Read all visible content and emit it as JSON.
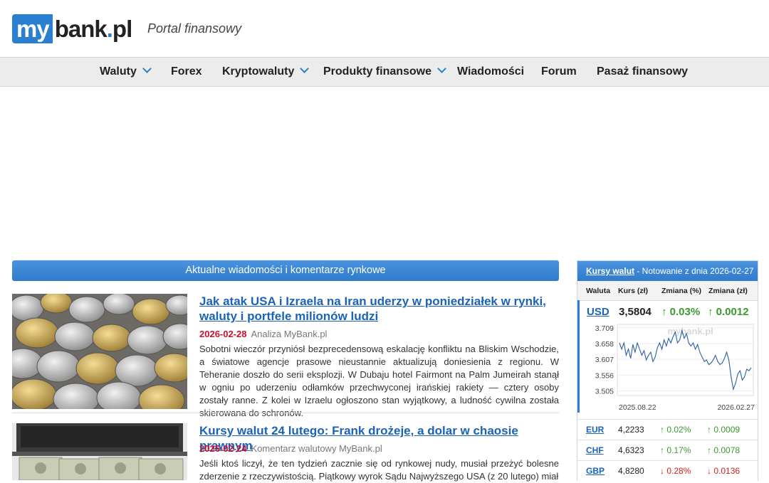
{
  "header": {
    "logo_my": "my",
    "logo_bank": "bank",
    "logo_dot": ".",
    "logo_pl": "pl",
    "tagline": "Portal finansowy"
  },
  "nav": {
    "items": [
      {
        "label": "Waluty",
        "dropdown": true
      },
      {
        "label": "Forex",
        "dropdown": false
      },
      {
        "label": "Kryptowaluty",
        "dropdown": true
      },
      {
        "label": "Produkty finansowe",
        "dropdown": true
      },
      {
        "label": "Wiadomości",
        "dropdown": false
      },
      {
        "label": "Forum",
        "dropdown": false
      },
      {
        "label": "Pasaż finansowy",
        "dropdown": false
      }
    ]
  },
  "news": {
    "section_title": "Aktualne wiadomości i komentarze rynkowe",
    "articles": [
      {
        "title": "Jak atak USA i Izraela na Iran uderzy w poniedziałek w rynki, waluty i portfele milionów ludzi",
        "date": "2026-02-28",
        "category": "Analiza MyBank.pl",
        "text": "Sobotni wieczór przyniósł bezprecedensową eskalację konfliktu na Bliskim Wschodzie, a światowe agencje prasowe nieustannie aktualizują doniesienia z regionu. W Teheranie doszło do serii eksplozji. W Dubaju hotel Fairmont na Palm Jumeirah stanął w ogniu po uderzeniu odłamków przechwyconej irańskiej rakiety — cztery osoby zostały ranne. Z kolei w Izraelu ogłoszono stan wyjątkowy, a ludność cywilna została skierowana do schronów."
      },
      {
        "title": "Kursy walut 24 lutego: Frank drożeje, a dolar w chaosie prawnym",
        "date": "2026-02-24",
        "category": "Komentarz walutowy MyBank.pl",
        "text": "Jeśli ktoś liczył, że ten tydzień zacznie się od rynkowej nudy, musiał przeżyć bolesne zderzenie z rzeczywistością. Piątkowy wyrok Sądu Najwyższego USA (z 20 lutego) miał"
      }
    ]
  },
  "rates": {
    "header_link": "Kursy walut",
    "header_suffix": " - Notowanie z dnia 2026-02-27",
    "columns": [
      "Waluta",
      "Kurs (zł)",
      "Zmiana (%)",
      "Zmiana (zł)"
    ],
    "usd": {
      "code": "USD",
      "rate": "3,5804",
      "pct": "↑ 0.03%",
      "chg": "↑ 0.0012"
    },
    "chart_watermark": "mybank.pl",
    "chart_data": {
      "type": "line",
      "title": "",
      "x_labels": [
        "2025.08.22",
        "2026.02.27"
      ],
      "y_ticks": [
        3.709,
        3.658,
        3.607,
        3.556,
        3.505
      ],
      "ylim": [
        3.49,
        3.72
      ],
      "values": [
        3.66,
        3.64,
        3.66,
        3.62,
        3.64,
        3.61,
        3.655,
        3.63,
        3.66,
        3.64,
        3.62,
        3.635,
        3.605,
        3.62,
        3.63,
        3.6,
        3.615,
        3.645,
        3.66,
        3.64,
        3.67,
        3.65,
        3.675,
        3.66,
        3.68,
        3.695,
        3.66,
        3.67,
        3.7,
        3.675,
        3.69,
        3.66,
        3.65,
        3.66,
        3.64,
        3.655,
        3.63,
        3.615,
        3.6,
        3.605,
        3.59,
        3.595,
        3.605,
        3.62,
        3.6,
        3.59,
        3.595,
        3.61,
        3.63,
        3.605,
        3.55,
        3.51,
        3.53,
        3.56,
        3.57,
        3.54,
        3.55,
        3.575,
        3.57,
        3.58
      ]
    },
    "others": [
      {
        "code": "EUR",
        "rate": "4,2233",
        "pct": "↑ 0.02%",
        "chg": "↑ 0.0009",
        "dir": "up"
      },
      {
        "code": "CHF",
        "rate": "4,6323",
        "pct": "↑ 0.17%",
        "chg": "↑ 0.0078",
        "dir": "up"
      },
      {
        "code": "GBP",
        "rate": "4,8280",
        "pct": "↓ 0.28%",
        "chg": "↓ 0.0136",
        "dir": "down"
      }
    ]
  }
}
